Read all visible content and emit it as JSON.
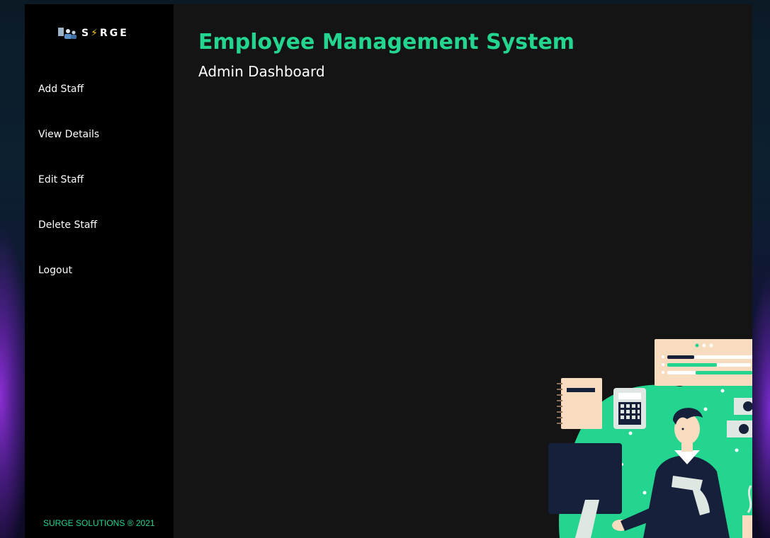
{
  "brand": {
    "icon": "people-icon",
    "text_before": "S",
    "bolt": "⚡",
    "text_after": "RGE"
  },
  "sidebar": {
    "items": [
      {
        "label": "Add Staff"
      },
      {
        "label": "View Details"
      },
      {
        "label": "Edit Staff"
      },
      {
        "label": "Delete Staff"
      },
      {
        "label": "Logout"
      }
    ],
    "footer": "SURGE SOLUTIONS ® 2021"
  },
  "main": {
    "title": "Employee Management System",
    "subtitle": "Admin Dashboard"
  },
  "colors": {
    "accent": "#23d58f",
    "sidebar_bg": "#000000",
    "main_bg": "#141414",
    "illustration_navy": "#16203a",
    "illustration_peach": "#f7dcc0"
  },
  "illustration": {
    "icon": "office-worker-illustration"
  }
}
